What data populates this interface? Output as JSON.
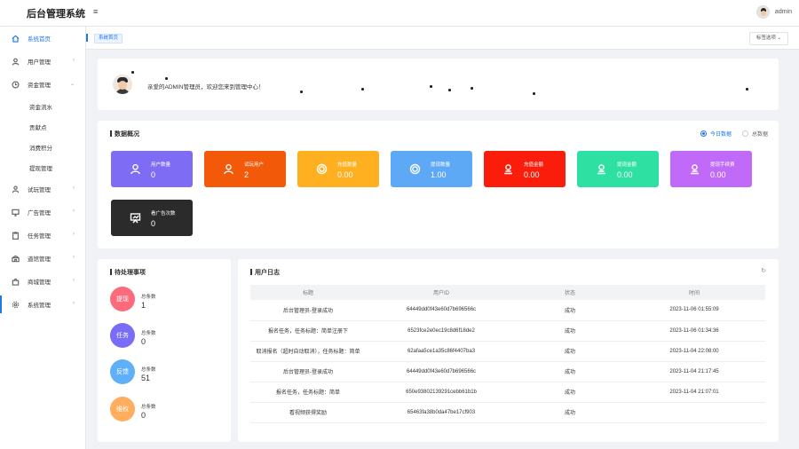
{
  "app": {
    "title": "后台管理系统",
    "menu_toggle": "≡"
  },
  "user": {
    "name": "admin"
  },
  "sidebar": {
    "items": [
      {
        "label": "系统首页",
        "icon": "home-icon",
        "has_arrow": false
      },
      {
        "label": "用户管理",
        "icon": "user-icon",
        "has_arrow": true
      },
      {
        "label": "资金管理",
        "icon": "clock-icon",
        "has_arrow": true,
        "expanded": true,
        "children": [
          "资金流水",
          "贡献点",
          "消费积分",
          "提现管理"
        ]
      },
      {
        "label": "试玩管理",
        "icon": "person-icon",
        "has_arrow": true
      },
      {
        "label": "广告管理",
        "icon": "monitor-icon",
        "has_arrow": true
      },
      {
        "label": "任务管理",
        "icon": "clipboard-icon",
        "has_arrow": true
      },
      {
        "label": "道馆管理",
        "icon": "building-icon",
        "has_arrow": true
      },
      {
        "label": "商城管理",
        "icon": "bag-icon",
        "has_arrow": true
      },
      {
        "label": "系统管理",
        "icon": "gear-icon",
        "has_arrow": true
      }
    ]
  },
  "tabs": {
    "active": "系统首页",
    "ops_label": "标签选项",
    "ops_arrow": "⌄"
  },
  "welcome": {
    "message": "亲爱的ADMIN管理员，欢迎您来到管理中心！"
  },
  "overview": {
    "title": "数据概况",
    "filters": [
      {
        "label": "今日数据",
        "checked": true
      },
      {
        "label": "总数据",
        "checked": false
      }
    ],
    "stats": [
      {
        "label": "用户数量",
        "value": "0",
        "color": "#7f6cf5",
        "icon": "user-icon"
      },
      {
        "label": "试玩用户",
        "value": "2",
        "color": "#f25a0a",
        "icon": "user-icon"
      },
      {
        "label": "充值数量",
        "value": "0.00",
        "color": "#ffb020",
        "icon": "coin-icon"
      },
      {
        "label": "提现数量",
        "value": "1.00",
        "color": "#5da9f5",
        "icon": "coin-icon"
      },
      {
        "label": "充值金额",
        "value": "0.00",
        "color": "#fb1d0c",
        "icon": "wallet-icon"
      },
      {
        "label": "提现金额",
        "value": "0.00",
        "color": "#2fe0a3",
        "icon": "wallet-icon"
      },
      {
        "label": "提现手续费",
        "value": "0.00",
        "color": "#c16af7",
        "icon": "wallet-icon"
      },
      {
        "label": "看广告次数",
        "value": "0",
        "color": "#2b2b2b",
        "icon": "presentation-icon"
      }
    ]
  },
  "todo": {
    "title": "待处理事项",
    "items": [
      {
        "badge": "提现",
        "label": "总条数",
        "value": "1",
        "color": "#fc6b7b"
      },
      {
        "badge": "任务",
        "label": "总条数",
        "value": "0",
        "color": "#7a6cf6"
      },
      {
        "badge": "反馈",
        "label": "总条数",
        "value": "51",
        "color": "#5fb0f7"
      },
      {
        "badge": "维权",
        "label": "总条数",
        "value": "0",
        "color": "#ffad5e"
      }
    ]
  },
  "log": {
    "title": "用户日志",
    "refresh_icon": "↻",
    "columns": [
      "标题",
      "用户ID",
      "状态",
      "时间"
    ],
    "rows": [
      [
        "后台管理员-登录成功",
        "64449dd0f43e60d7b696566c",
        "成功",
        "2023-11-06 01:55:09"
      ],
      [
        "报名任务，任务标题：简单注册下",
        "6523fce2e0ec19c8d6f18de2",
        "成功",
        "2023-11-06 01:34:36"
      ],
      [
        "取消报名（超时自动取消），任务标题：简单",
        "62afaa5ce1a35c86f4407ba3",
        "成功",
        "2023-11-04 22:08:00"
      ],
      [
        "后台管理员-登录成功",
        "64449dd0f43e60d7b696566c",
        "成功",
        "2023-11-04 21:17:45"
      ],
      [
        "报名任务，任务标题：简单",
        "650e93802139291cebb61b1b",
        "成功",
        "2023-11-04 21:07:01"
      ],
      [
        "看视频获得奖励",
        "65463fa38b0da47be17cf903",
        "成功",
        ""
      ]
    ]
  }
}
